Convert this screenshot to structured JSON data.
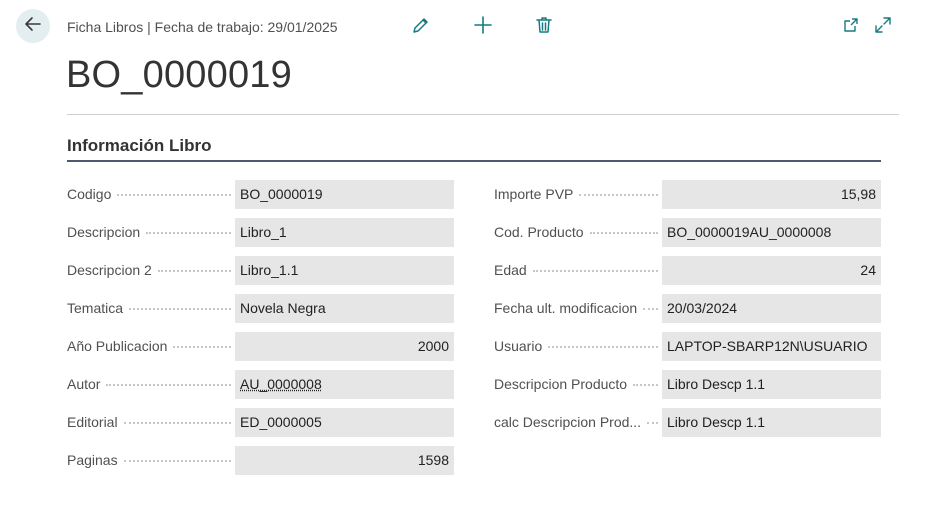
{
  "header": {
    "breadcrumb": "Ficha Libros | Fecha de trabajo: 29/01/2025",
    "title": "BO_0000019"
  },
  "section": {
    "title": "Información Libro"
  },
  "left_fields": [
    {
      "label": "Codigo",
      "value": "BO_0000019"
    },
    {
      "label": "Descripcion",
      "value": "Libro_1"
    },
    {
      "label": "Descripcion 2",
      "value": "Libro_1.1"
    },
    {
      "label": "Tematica",
      "value": "Novela Negra"
    },
    {
      "label": "Año Publicacion",
      "value": "2000"
    },
    {
      "label": "Autor",
      "value": "AU_0000008"
    },
    {
      "label": "Editorial",
      "value": "ED_0000005"
    },
    {
      "label": "Paginas",
      "value": "1598"
    }
  ],
  "right_fields": [
    {
      "label": "Importe PVP",
      "value": "15,98"
    },
    {
      "label": "Cod. Producto",
      "value": "BO_0000019AU_0000008"
    },
    {
      "label": "Edad",
      "value": "24"
    },
    {
      "label": "Fecha ult. modificacion",
      "value": "20/03/2024"
    },
    {
      "label": "Usuario",
      "value": "LAPTOP-SBARP12N\\USUARIO"
    },
    {
      "label": "Descripcion Producto",
      "value": "Libro Descp 1.1"
    },
    {
      "label": "calc Descripcion Prod...",
      "value": "Libro Descp 1.1"
    }
  ],
  "icons": {
    "back": "back-arrow-icon",
    "edit": "pencil-icon",
    "new": "plus-icon",
    "delete": "trash-icon",
    "open_new_window": "open-in-new-window-icon",
    "expand": "expand-icon"
  },
  "colors": {
    "accent": "#167a80",
    "back_button_bg": "#e3eef1",
    "field_bg": "#e6e6e6",
    "section_rule": "#4e5b6e"
  }
}
